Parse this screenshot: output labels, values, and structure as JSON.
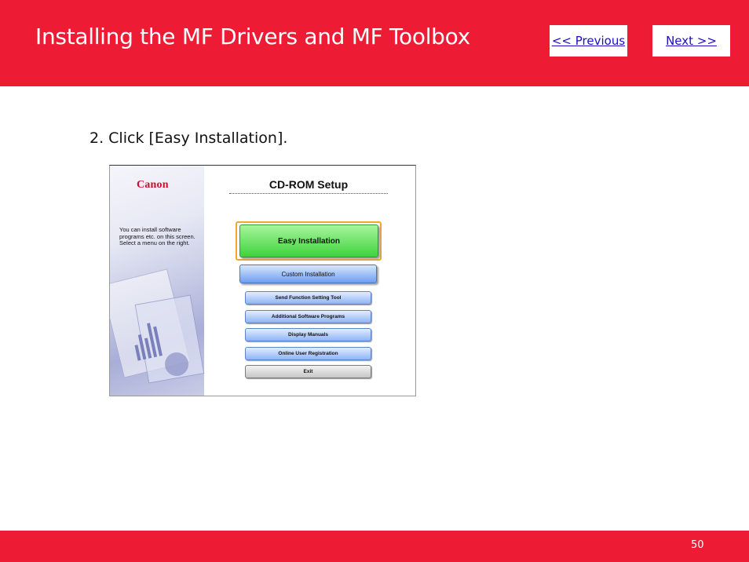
{
  "slide": {
    "title": "Installing the MF Drivers and MF Toolbox",
    "prev_label": "<< Previous",
    "next_label": "Next >>",
    "step_text": "2. Click [Easy Installation].",
    "page_number": "50",
    "colors": {
      "brand_red": "#ee1b35",
      "link_blue": "#1a0dcc"
    }
  },
  "screenshot": {
    "logo": "Canon",
    "title": "CD-ROM Setup",
    "description": "You can install software programs etc. on this screen. Select a menu on the right.",
    "highlight_color": "#f5a623",
    "buttons": {
      "easy": "Easy Installation",
      "custom": "Custom Installation",
      "send_function": "Send Function Setting Tool",
      "additional": "Additional Software Programs",
      "manuals": "Display Manuals",
      "registration": "Online User Registration",
      "exit": "Exit"
    }
  }
}
